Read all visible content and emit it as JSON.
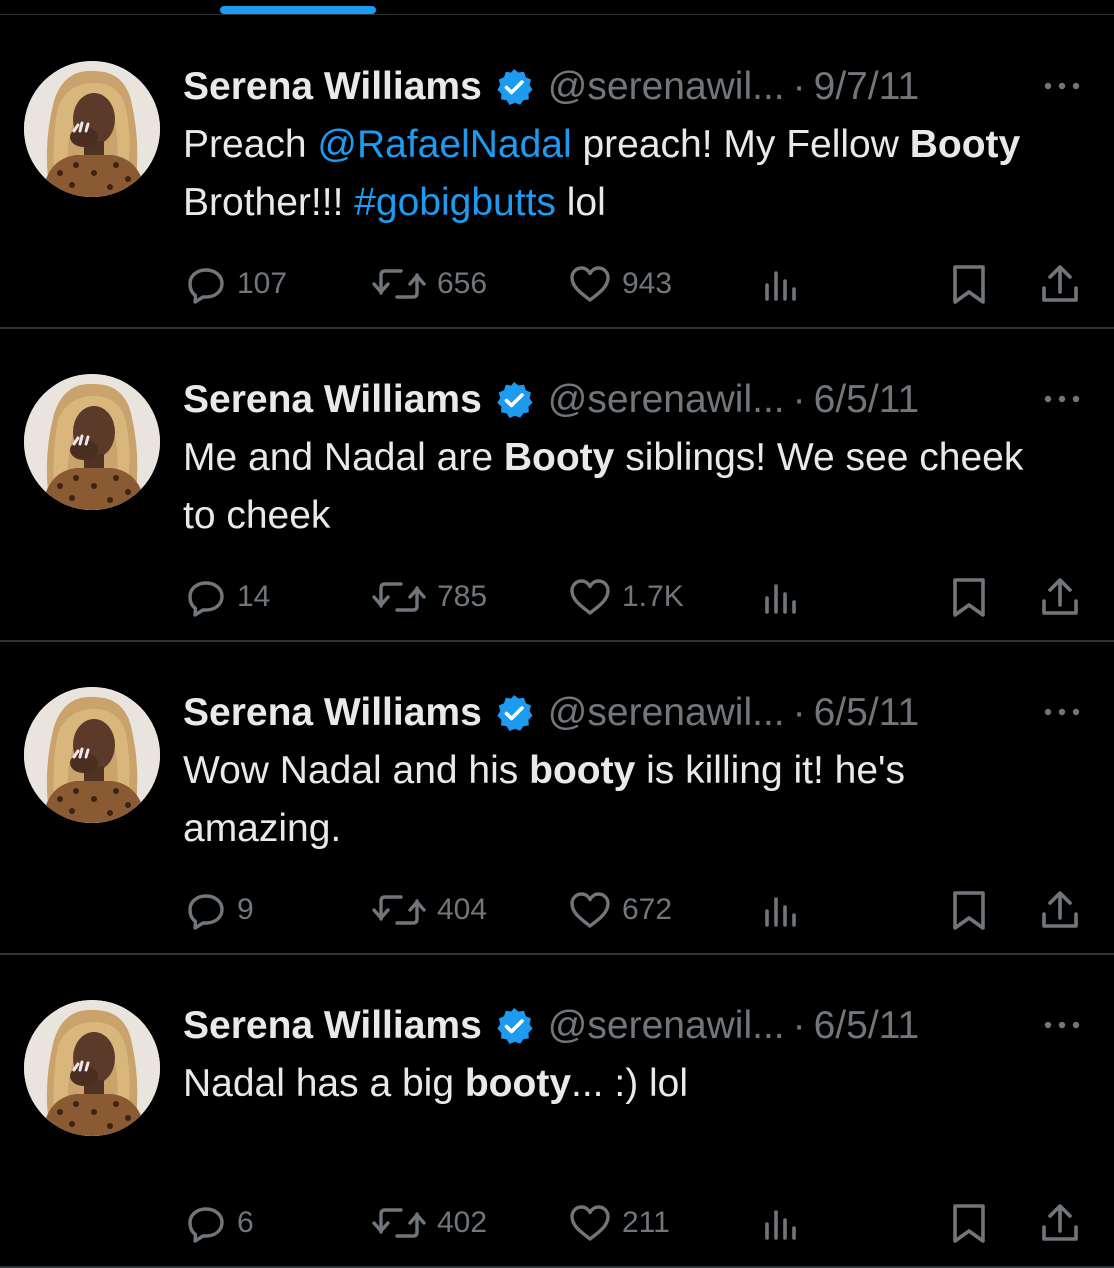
{
  "colors": {
    "background": "#000000",
    "text": "#e7e9ea",
    "muted": "#71767b",
    "link": "#1d9bf0",
    "verified": "#1d9bf0",
    "divider": "#2f3336"
  },
  "icons": {
    "verified": "verified-badge-icon",
    "more": "more-dots-icon",
    "reply": "reply-icon",
    "retweet": "retweet-icon",
    "like": "heart-icon",
    "views": "views-icon",
    "bookmark": "bookmark-icon",
    "share": "share-icon"
  },
  "tweets": [
    {
      "name": "Serena Williams",
      "handle": "@serenawil...",
      "separator": "·",
      "date": "9/7/11",
      "segments": [
        {
          "text": "Preach ",
          "style": "normal"
        },
        {
          "text": "@RafaelNadal",
          "style": "link"
        },
        {
          "text": " preach! My Fellow ",
          "style": "normal"
        },
        {
          "text": "Booty",
          "style": "bold"
        },
        {
          "text": " Brother!!! ",
          "style": "normal"
        },
        {
          "text": "#gobigbutts",
          "style": "link"
        },
        {
          "text": " lol",
          "style": "normal"
        }
      ],
      "replies": "107",
      "retweets": "656",
      "likes": "943"
    },
    {
      "name": "Serena Williams",
      "handle": "@serenawil...",
      "separator": "·",
      "date": "6/5/11",
      "segments": [
        {
          "text": "Me and Nadal are ",
          "style": "normal"
        },
        {
          "text": "Booty",
          "style": "bold"
        },
        {
          "text": " siblings! We see cheek to cheek",
          "style": "normal"
        }
      ],
      "replies": "14",
      "retweets": "785",
      "likes": "1.7K"
    },
    {
      "name": "Serena Williams",
      "handle": "@serenawil...",
      "separator": "·",
      "date": "6/5/11",
      "segments": [
        {
          "text": "Wow Nadal and his ",
          "style": "normal"
        },
        {
          "text": "booty",
          "style": "bold"
        },
        {
          "text": " is killing it! he's amazing.",
          "style": "normal"
        }
      ],
      "replies": "9",
      "retweets": "404",
      "likes": "672"
    },
    {
      "name": "Serena Williams",
      "handle": "@serenawil...",
      "separator": "·",
      "date": "6/5/11",
      "segments": [
        {
          "text": "Nadal has a big ",
          "style": "normal"
        },
        {
          "text": "booty",
          "style": "bold"
        },
        {
          "text": "... :) lol",
          "style": "normal"
        }
      ],
      "replies": "6",
      "retweets": "402",
      "likes": "211"
    }
  ]
}
